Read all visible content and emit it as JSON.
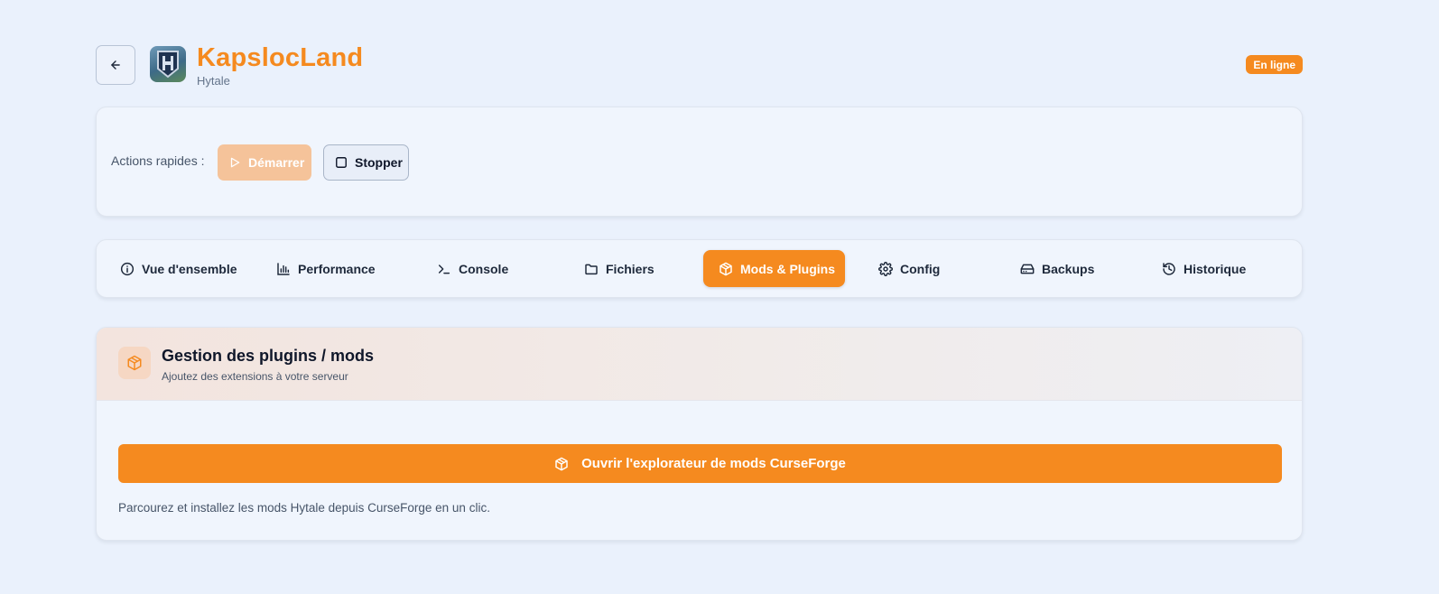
{
  "header": {
    "back_icon": "arrow-left-icon",
    "server_name": "KapslocLand",
    "game": "Hytale",
    "status": "En ligne"
  },
  "quick_actions": {
    "label": "Actions rapides :",
    "start_label": "Démarrer",
    "stop_label": "Stopper"
  },
  "tabs": [
    {
      "label": "Vue d'ensemble",
      "icon": "info-icon"
    },
    {
      "label": "Performance",
      "icon": "bar-chart-icon"
    },
    {
      "label": "Console",
      "icon": "terminal-icon"
    },
    {
      "label": "Fichiers",
      "icon": "folder-icon"
    },
    {
      "label": "Mods & Plugins",
      "icon": "package-icon",
      "active": true
    },
    {
      "label": "Config",
      "icon": "gear-icon"
    },
    {
      "label": "Backups",
      "icon": "hard-drive-icon"
    },
    {
      "label": "Historique",
      "icon": "history-icon"
    }
  ],
  "plugins": {
    "title": "Gestion des plugins / mods",
    "subtitle": "Ajoutez des extensions à votre serveur",
    "button_label": "Ouvrir l'explorateur de mods CurseForge",
    "help_text": "Parcourez et installez les mods Hytale depuis CurseForge en un clic."
  },
  "colors": {
    "accent": "#f58a1f",
    "background": "#eaf1fc",
    "card": "#f0f5fd"
  }
}
